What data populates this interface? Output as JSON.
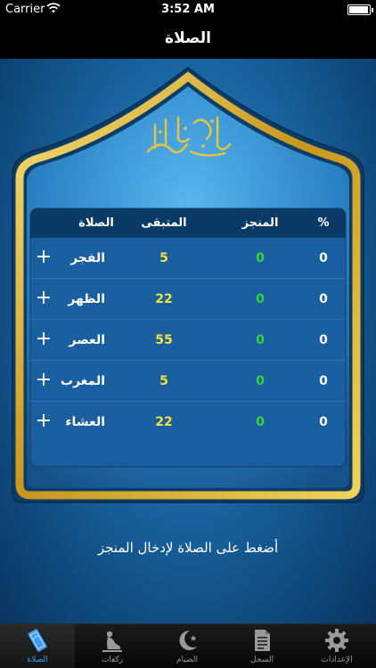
{
  "status_bar": {
    "carrier": "Carrier",
    "time": "3:52 AM",
    "battery_level": 0.95
  },
  "nav": {
    "title": "الصلاة"
  },
  "table": {
    "headers": {
      "percent": "%",
      "done": "المنجز",
      "remaining": "المتبقى",
      "prayer": "الصلاة"
    },
    "rows": [
      {
        "name": "الفجر",
        "remaining": "5",
        "done": "0",
        "percent": "0",
        "add": "+"
      },
      {
        "name": "الظهر",
        "remaining": "22",
        "done": "0",
        "percent": "0",
        "add": "+"
      },
      {
        "name": "العصر",
        "remaining": "55",
        "done": "0",
        "percent": "0",
        "add": "+"
      },
      {
        "name": "المغرب",
        "remaining": "5",
        "done": "0",
        "percent": "0",
        "add": "+"
      },
      {
        "name": "العشاء",
        "remaining": "22",
        "done": "0",
        "percent": "0",
        "add": "+"
      }
    ]
  },
  "hint": "أضغط على الصلاة لإدخال المنجز",
  "tabs": [
    {
      "label": "الصلاة",
      "icon": "prayer-mat-icon",
      "active": true
    },
    {
      "label": "ركعات",
      "icon": "kneeling-figure-icon",
      "active": false
    },
    {
      "label": "الصيام",
      "icon": "crescent-star-icon",
      "active": false
    },
    {
      "label": "السجل",
      "icon": "document-icon",
      "active": false
    },
    {
      "label": "الإعدادات",
      "icon": "gear-icon",
      "active": false
    }
  ],
  "colors": {
    "done_value": "#37d23c",
    "remaining_value": "#f5e33b",
    "active_tab": "#3e9bf0",
    "arch_gold": "#d8b22a"
  }
}
